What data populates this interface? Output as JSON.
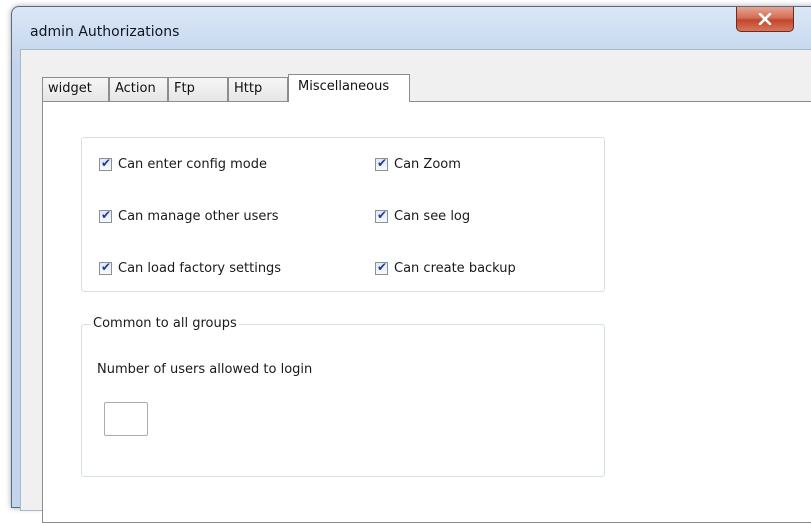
{
  "window": {
    "title": "admin Authorizations",
    "close_label": "close"
  },
  "tabs": [
    {
      "label": "widget"
    },
    {
      "label": "Action"
    },
    {
      "label": "Ftp"
    },
    {
      "label": "Http"
    },
    {
      "label": "Miscellaneous",
      "active": true
    }
  ],
  "permissions": {
    "left": [
      {
        "label": "Can enter config mode",
        "checked": true
      },
      {
        "label": "Can manage other users",
        "checked": true
      },
      {
        "label": "Can load factory settings",
        "checked": true
      }
    ],
    "right": [
      {
        "label": "Can Zoom",
        "checked": true
      },
      {
        "label": "Can see log",
        "checked": true
      },
      {
        "label": "Can create backup",
        "checked": true
      }
    ]
  },
  "common": {
    "legend": "Common to all groups",
    "users_label": "Number of users allowed to login",
    "users_value": ""
  },
  "colors": {
    "close_button": "#c3472b",
    "check_mark": "#22389c"
  }
}
